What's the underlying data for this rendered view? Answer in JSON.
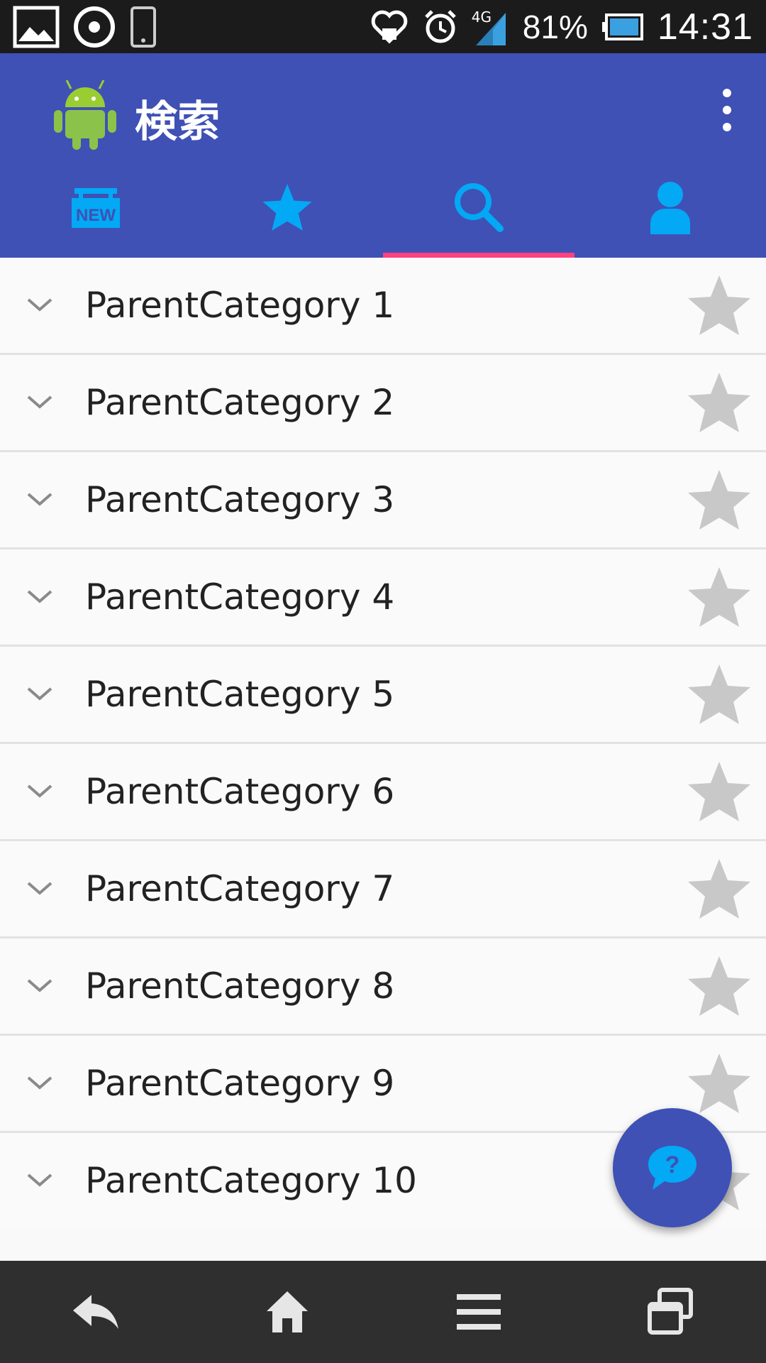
{
  "status_bar": {
    "battery_percent": "81%",
    "time": "14:31",
    "network_label": "4G",
    "left_icons": [
      "image-icon",
      "sync-circle-icon",
      "phone-icon"
    ],
    "right_icons": [
      "heart-notification-icon",
      "alarm-icon",
      "signal-icon",
      "battery-icon"
    ]
  },
  "app_bar": {
    "title": "検索",
    "logo_icon": "android-icon",
    "menu_icon": "overflow-menu-icon",
    "color": "#3f51b5"
  },
  "tabs": [
    {
      "icon": "new-badge-icon",
      "label": "NEW",
      "selected": false
    },
    {
      "icon": "star-icon",
      "selected": false
    },
    {
      "icon": "search-icon",
      "selected": true
    },
    {
      "icon": "person-icon",
      "selected": false
    }
  ],
  "tab_accent_color": "#03a9f4",
  "tab_indicator_color": "#ff4081",
  "categories": [
    {
      "label": "ParentCategory 1"
    },
    {
      "label": "ParentCategory 2"
    },
    {
      "label": "ParentCategory 3"
    },
    {
      "label": "ParentCategory 4"
    },
    {
      "label": "ParentCategory 5"
    },
    {
      "label": "ParentCategory 6"
    },
    {
      "label": "ParentCategory 7"
    },
    {
      "label": "ParentCategory 8"
    },
    {
      "label": "ParentCategory 9"
    },
    {
      "label": "ParentCategory 10"
    }
  ],
  "fab": {
    "icon": "help-chat-icon",
    "label": "?"
  },
  "nav_bar": [
    "back-icon",
    "home-icon",
    "menu-icon",
    "recent-apps-icon"
  ]
}
